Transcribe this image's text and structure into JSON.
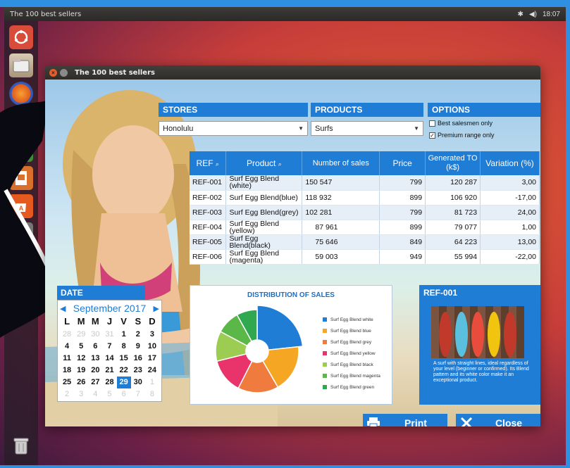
{
  "top_panel": {
    "title": "The 100 best sellers",
    "time": "18:07",
    "bluetooth_icon": "bluetooth-icon",
    "volume_icon": "volume-icon"
  },
  "launcher": {
    "items": [
      "ubuntu-dash-icon",
      "file-manager-icon",
      "firefox-icon",
      "text-editor-icon",
      "spreadsheet-icon",
      "presentation-icon",
      "software-center-icon",
      "settings-icon",
      "trash-icon"
    ]
  },
  "window": {
    "title": "The 100 best sellers"
  },
  "stores": {
    "header": "STORES",
    "value": "Honolulu"
  },
  "products": {
    "header": "PRODUCTS",
    "value": "Surfs"
  },
  "options": {
    "header": "OPTIONS",
    "best_salesmen": "Best salesmen only",
    "best_salesmen_checked": false,
    "premium": "Premium range only",
    "premium_checked": true
  },
  "table": {
    "columns": [
      "REF",
      "Product",
      "Number of sales",
      "Price",
      "Generated TO (k$)",
      "Variation (%)"
    ],
    "rows": [
      {
        "ref": "REF-001",
        "product": "Surf Egg Blend (white)",
        "sales": "150 547",
        "price": "799",
        "to": "120 287",
        "variation": "3,00"
      },
      {
        "ref": "REF-002",
        "product": "Surf Egg Blend(blue)",
        "sales": "118 932",
        "price": "899",
        "to": "106 920",
        "variation": "-17,00"
      },
      {
        "ref": "REF-003",
        "product": "Surf Egg Blend(grey)",
        "sales": "102 281",
        "price": "799",
        "to": "81 723",
        "variation": "24,00"
      },
      {
        "ref": "REF-004",
        "product": "Surf Egg Blend (yellow)",
        "sales": "87 961",
        "price": "899",
        "to": "79 077",
        "variation": "1,00"
      },
      {
        "ref": "REF-005",
        "product": "Surf Egg Blend(black)",
        "sales": "75 646",
        "price": "849",
        "to": "64 223",
        "variation": "13,00"
      },
      {
        "ref": "REF-006",
        "product": "Surf Egg Blend (magenta)",
        "sales": "59 003",
        "price": "949",
        "to": "55 994",
        "variation": "-22,00"
      }
    ]
  },
  "date": {
    "header": "DATE",
    "month_label": "September 2017",
    "dows": [
      "L",
      "M",
      "M",
      "J",
      "V",
      "S",
      "D"
    ],
    "weeks": [
      [
        {
          "d": "28",
          "m": true
        },
        {
          "d": "29",
          "m": true
        },
        {
          "d": "30",
          "m": true
        },
        {
          "d": "31",
          "m": true
        },
        {
          "d": "1"
        },
        {
          "d": "2"
        },
        {
          "d": "3"
        }
      ],
      [
        {
          "d": "4"
        },
        {
          "d": "5"
        },
        {
          "d": "6"
        },
        {
          "d": "7"
        },
        {
          "d": "8"
        },
        {
          "d": "9"
        },
        {
          "d": "10"
        }
      ],
      [
        {
          "d": "11"
        },
        {
          "d": "12"
        },
        {
          "d": "13"
        },
        {
          "d": "14"
        },
        {
          "d": "15"
        },
        {
          "d": "16"
        },
        {
          "d": "17"
        }
      ],
      [
        {
          "d": "18"
        },
        {
          "d": "19"
        },
        {
          "d": "20"
        },
        {
          "d": "21"
        },
        {
          "d": "22"
        },
        {
          "d": "23"
        },
        {
          "d": "24"
        }
      ],
      [
        {
          "d": "25"
        },
        {
          "d": "26"
        },
        {
          "d": "27"
        },
        {
          "d": "28"
        },
        {
          "d": "29",
          "sel": true
        },
        {
          "d": "30"
        },
        {
          "d": "1",
          "m": true
        }
      ],
      [
        {
          "d": "2",
          "m": true
        },
        {
          "d": "3",
          "m": true
        },
        {
          "d": "4",
          "m": true
        },
        {
          "d": "5",
          "m": true
        },
        {
          "d": "6",
          "m": true
        },
        {
          "d": "7",
          "m": true
        },
        {
          "d": "8",
          "m": true
        }
      ]
    ]
  },
  "chart": {
    "title": "DISTRIBUTION OF SALES"
  },
  "chart_data": {
    "type": "pie",
    "title": "DISTRIBUTION OF SALES",
    "legend_position": "right",
    "series": [
      {
        "name": "Surf Egg Blend white",
        "value": 150547,
        "color": "#1f7dd6"
      },
      {
        "name": "Surf Egg Blend blue",
        "value": 118932,
        "color": "#f5a623"
      },
      {
        "name": "Surf Egg Blend grey",
        "value": 102281,
        "color": "#f07b3f"
      },
      {
        "name": "Surf Egg Blend yellow",
        "value": 87961,
        "color": "#e8336b"
      },
      {
        "name": "Surf Egg Blend black",
        "value": 75646,
        "color": "#9ccc52"
      },
      {
        "name": "Surf Egg Blend magenta",
        "value": 59003,
        "color": "#5bb848"
      },
      {
        "name": "Surf Egg Blend green",
        "value": 52000,
        "color": "#2fa84f"
      }
    ]
  },
  "ref_panel": {
    "title": "REF-001",
    "description": "A surf with straight lines, ideal regardless of your level (beginner or confirmed). Its Blend pattern and its white color make it an exceptional product.",
    "board_colors": [
      "#c0392b",
      "#5bc0de",
      "#e74c3c",
      "#f1c40f",
      "#c0392b"
    ]
  },
  "buttons": {
    "print": "Print",
    "close": "Close"
  },
  "colors": {
    "accent": "#1f7dd6",
    "frame": "#2f8fe0"
  }
}
